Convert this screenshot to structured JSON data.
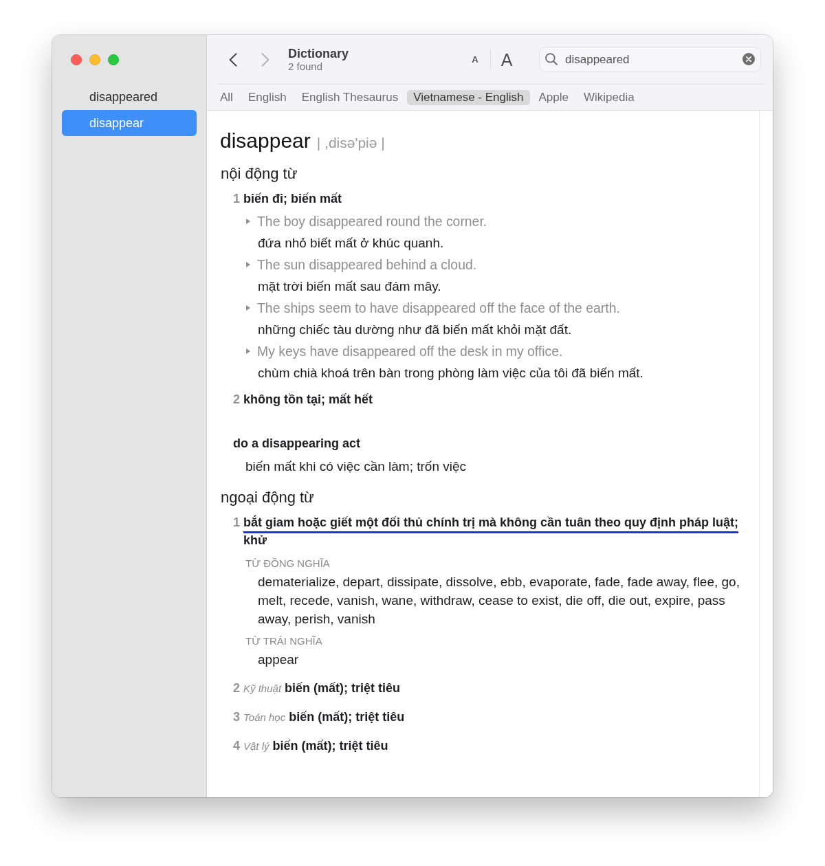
{
  "window": {
    "title": "Dictionary",
    "subtitle": "2 found"
  },
  "sidebar": {
    "items": [
      {
        "label": "disappeared",
        "selected": false
      },
      {
        "label": "disappear",
        "selected": true
      }
    ]
  },
  "toolbar": {
    "navigation": [
      {
        "kind": "back",
        "disabled": false
      },
      {
        "kind": "forward",
        "disabled": true
      }
    ],
    "font_size_buttons": [
      {
        "kind": "smaller",
        "label": "A"
      },
      {
        "kind": "larger",
        "label": "A"
      }
    ],
    "search": {
      "value": "disappeared"
    }
  },
  "tabs": [
    {
      "label": "All",
      "selected": false
    },
    {
      "label": "English",
      "selected": false
    },
    {
      "label": "English Thesaurus",
      "selected": false
    },
    {
      "label": "Vietnamese - English",
      "selected": true
    },
    {
      "label": "Apple",
      "selected": false
    },
    {
      "label": "Wikipedia",
      "selected": false
    }
  ],
  "entry": {
    "headword": "disappear",
    "pronunciation": "| ,disə'piə |",
    "blocks": [
      {
        "kind": "part_of_speech",
        "label": "nội động từ",
        "senses": [
          {
            "number": "1",
            "gloss": "biến đi; biến mất",
            "underlined": false,
            "examples": [
              {
                "text": "The boy disappeared round the corner.",
                "translation": "đứa nhỏ biết mất ở khúc quanh."
              },
              {
                "text": "The sun disappeared behind a cloud.",
                "translation": "mặt trời biến mất sau đám mây."
              },
              {
                "text": "The ships seem to have disappeared off the face of the earth.",
                "translation": "những chiếc tàu dường như đã biến mất khỏi mặt đất."
              },
              {
                "text": "My keys have disappeared off the desk in my office.",
                "translation": "chùm chià khoá trên bàn trong phòng làm việc của tôi đã biến mất."
              }
            ]
          },
          {
            "number": "2",
            "gloss": "không tồn tại; mất hết",
            "underlined": false
          }
        ]
      },
      {
        "kind": "phrase",
        "label": "do a disappearing act",
        "meaning": "biến mất khi có việc cần làm; trốn việc"
      },
      {
        "kind": "part_of_speech",
        "label": "ngoại động từ",
        "senses": [
          {
            "number": "1",
            "gloss": "bắt giam hoặc giết một đối thủ chính trị mà không cần tuân theo quy định pháp luật; khử",
            "underlined": true,
            "synonyms": {
              "label": "TỪ ĐỒNG NGHĨA",
              "text": "dematerialize, depart, dissipate, dissolve, ebb, evaporate, fade, fade away, flee, go, melt, recede, vanish, wane, withdraw, cease to exist, die off, die out, expire, pass away, perish, vanish"
            },
            "antonyms": {
              "label": "TỪ TRÁI NGHĨA",
              "text": "appear"
            }
          },
          {
            "number": "2",
            "domain": "Kỹ thuật",
            "gloss": "biến (mất); triệt tiêu",
            "underlined": false
          },
          {
            "number": "3",
            "domain": "Toán học",
            "gloss": "biến (mất); triệt tiêu",
            "underlined": false
          },
          {
            "number": "4",
            "domain": "Vật lý",
            "gloss": "biến (mất); triệt tiêu",
            "underlined": false
          }
        ]
      }
    ]
  }
}
